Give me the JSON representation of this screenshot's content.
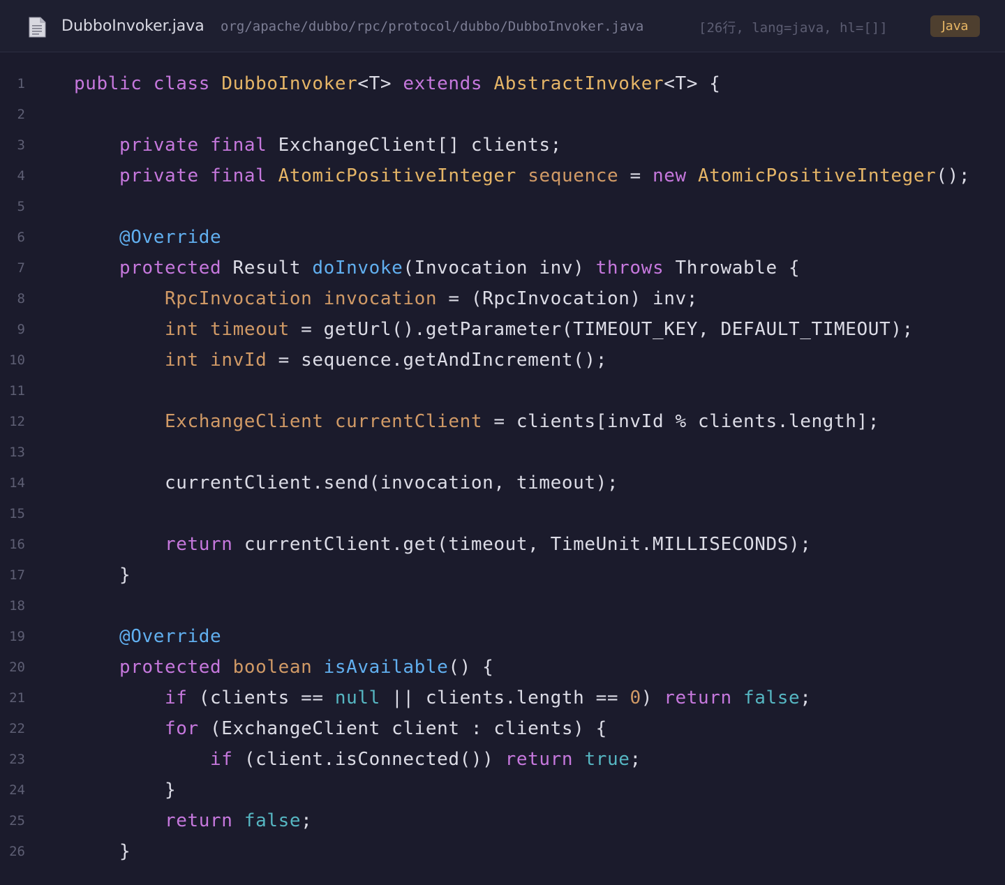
{
  "header": {
    "file_name": "DubboInvoker.java",
    "file_path": "org/apache/dubbo/rpc/protocol/dubbo/DubboInvoker.java",
    "meta": "[26行, lang=java, hl=[]]",
    "language": "Java",
    "icon": "document-icon"
  },
  "colors": {
    "background": "#1b1b2c",
    "keyword": "#c678dd",
    "type": "#e5b567",
    "variable": "#d19a66",
    "function": "#61afef",
    "literal": "#56b6c2",
    "text": "#dcdce6",
    "line_number": "#5e5f74"
  },
  "code": {
    "lines": [
      {
        "n": "1",
        "tokens": [
          [
            "kw",
            "public"
          ],
          [
            "t",
            " "
          ],
          [
            "kw",
            "class"
          ],
          [
            "t",
            " "
          ],
          [
            "ty",
            "DubboInvoker"
          ],
          [
            "t",
            "<T> "
          ],
          [
            "kw",
            "extends"
          ],
          [
            "t",
            " "
          ],
          [
            "ty",
            "AbstractInvoker"
          ],
          [
            "t",
            "<T> {"
          ]
        ]
      },
      {
        "n": "2",
        "tokens": []
      },
      {
        "n": "3",
        "tokens": [
          [
            "t",
            "    "
          ],
          [
            "kw",
            "private"
          ],
          [
            "t",
            " "
          ],
          [
            "kw",
            "final"
          ],
          [
            "t",
            " ExchangeClient[] clients;"
          ]
        ]
      },
      {
        "n": "4",
        "tokens": [
          [
            "t",
            "    "
          ],
          [
            "kw",
            "private"
          ],
          [
            "t",
            " "
          ],
          [
            "kw",
            "final"
          ],
          [
            "t",
            " "
          ],
          [
            "ty",
            "AtomicPositiveInteger"
          ],
          [
            "t",
            " "
          ],
          [
            "vr",
            "sequence"
          ],
          [
            "t",
            " = "
          ],
          [
            "kw",
            "new"
          ],
          [
            "t",
            " "
          ],
          [
            "ty",
            "AtomicPositiveInteger"
          ],
          [
            "t",
            "();"
          ]
        ]
      },
      {
        "n": "5",
        "tokens": []
      },
      {
        "n": "6",
        "tokens": [
          [
            "t",
            "    "
          ],
          [
            "an",
            "@Override"
          ]
        ]
      },
      {
        "n": "7",
        "tokens": [
          [
            "t",
            "    "
          ],
          [
            "kw",
            "protected"
          ],
          [
            "t",
            " Result "
          ],
          [
            "fn",
            "doInvoke"
          ],
          [
            "t",
            "(Invocation inv) "
          ],
          [
            "kw",
            "throws"
          ],
          [
            "t",
            " Throwable {"
          ]
        ]
      },
      {
        "n": "8",
        "tokens": [
          [
            "t",
            "        "
          ],
          [
            "vr",
            "RpcInvocation"
          ],
          [
            "t",
            " "
          ],
          [
            "vr",
            "invocation"
          ],
          [
            "t",
            " = (RpcInvocation) inv;"
          ]
        ]
      },
      {
        "n": "9",
        "tokens": [
          [
            "t",
            "        "
          ],
          [
            "vr",
            "int"
          ],
          [
            "t",
            " "
          ],
          [
            "vr",
            "timeout"
          ],
          [
            "t",
            " = getUrl().getParameter(TIMEOUT_KEY, DEFAULT_TIMEOUT);"
          ]
        ]
      },
      {
        "n": "10",
        "tokens": [
          [
            "t",
            "        "
          ],
          [
            "vr",
            "int"
          ],
          [
            "t",
            " "
          ],
          [
            "vr",
            "invId"
          ],
          [
            "t",
            " = sequence.getAndIncrement();"
          ]
        ]
      },
      {
        "n": "11",
        "tokens": []
      },
      {
        "n": "12",
        "tokens": [
          [
            "t",
            "        "
          ],
          [
            "vr",
            "ExchangeClient"
          ],
          [
            "t",
            " "
          ],
          [
            "vr",
            "currentClient"
          ],
          [
            "t",
            " = clients[invId % clients.length];"
          ]
        ]
      },
      {
        "n": "13",
        "tokens": []
      },
      {
        "n": "14",
        "tokens": [
          [
            "t",
            "        currentClient.send(invocation, timeout);"
          ]
        ]
      },
      {
        "n": "15",
        "tokens": []
      },
      {
        "n": "16",
        "tokens": [
          [
            "t",
            "        "
          ],
          [
            "kw",
            "return"
          ],
          [
            "t",
            " currentClient.get(timeout, TimeUnit.MILLISECONDS);"
          ]
        ]
      },
      {
        "n": "17",
        "tokens": [
          [
            "t",
            "    }"
          ]
        ]
      },
      {
        "n": "18",
        "tokens": []
      },
      {
        "n": "19",
        "tokens": [
          [
            "t",
            "    "
          ],
          [
            "an",
            "@Override"
          ]
        ]
      },
      {
        "n": "20",
        "tokens": [
          [
            "t",
            "    "
          ],
          [
            "kw",
            "protected"
          ],
          [
            "t",
            " "
          ],
          [
            "vr",
            "boolean"
          ],
          [
            "t",
            " "
          ],
          [
            "fn",
            "isAvailable"
          ],
          [
            "t",
            "() {"
          ]
        ]
      },
      {
        "n": "21",
        "tokens": [
          [
            "t",
            "        "
          ],
          [
            "kw",
            "if"
          ],
          [
            "t",
            " (clients == "
          ],
          [
            "lit",
            "null"
          ],
          [
            "t",
            " || clients.length == "
          ],
          [
            "num",
            "0"
          ],
          [
            "t",
            ") "
          ],
          [
            "kw",
            "return"
          ],
          [
            "t",
            " "
          ],
          [
            "lit",
            "false"
          ],
          [
            "t",
            ";"
          ]
        ]
      },
      {
        "n": "22",
        "tokens": [
          [
            "t",
            "        "
          ],
          [
            "kw",
            "for"
          ],
          [
            "t",
            " (ExchangeClient client : clients) {"
          ]
        ]
      },
      {
        "n": "23",
        "tokens": [
          [
            "t",
            "            "
          ],
          [
            "kw",
            "if"
          ],
          [
            "t",
            " (client.isConnected()) "
          ],
          [
            "kw",
            "return"
          ],
          [
            "t",
            " "
          ],
          [
            "lit",
            "true"
          ],
          [
            "t",
            ";"
          ]
        ]
      },
      {
        "n": "24",
        "tokens": [
          [
            "t",
            "        }"
          ]
        ]
      },
      {
        "n": "25",
        "tokens": [
          [
            "t",
            "        "
          ],
          [
            "kw",
            "return"
          ],
          [
            "t",
            " "
          ],
          [
            "lit",
            "false"
          ],
          [
            "t",
            ";"
          ]
        ]
      },
      {
        "n": "26",
        "tokens": [
          [
            "t",
            "    }"
          ]
        ]
      }
    ]
  }
}
